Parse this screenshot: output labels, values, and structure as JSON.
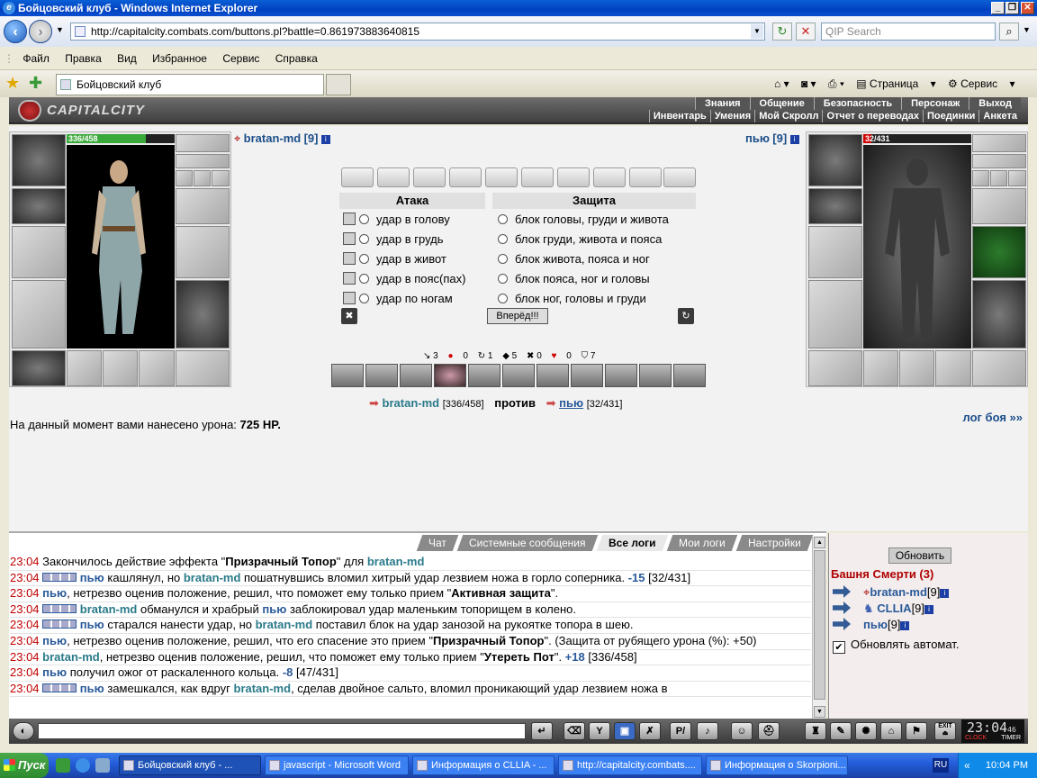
{
  "window": {
    "title": "Бойцовский клуб - Windows Internet Explorer"
  },
  "address": {
    "url": "http://capitalcity.combats.com/buttons.pl?battle=0.861973883640815",
    "search_placeholder": "QIP Search"
  },
  "menu": [
    "Файл",
    "Правка",
    "Вид",
    "Избранное",
    "Сервис",
    "Справка"
  ],
  "tab": {
    "title": "Бойцовский клуб"
  },
  "cmdbar": {
    "page": "Страница",
    "tools": "Сервис"
  },
  "game": {
    "logo": "CAPITALCITY",
    "nav_top": [
      "Знания",
      "Общение",
      "Безопасность",
      "Персонаж",
      "Выход"
    ],
    "nav_bottom": [
      "Инвентарь",
      "Умения",
      "Мой Скролл",
      "Отчет о переводах",
      "Поединки",
      "Анкета"
    ],
    "player": {
      "name": "bratan-md",
      "level": "[9]",
      "hp": "336/458",
      "hp_fraction": 0.733,
      "hp_color": "#39a939"
    },
    "enemy": {
      "name": "пью",
      "level": "[9]",
      "hp": "32/431",
      "hp_fraction": 0.074,
      "hp_color": "#d00000"
    },
    "attack_header": "Атака",
    "defense_header": "Защита",
    "attacks": [
      "удар в голову",
      "удар в грудь",
      "удар в живот",
      "удар в пояс(пах)",
      "удар по ногам"
    ],
    "defenses": [
      "блок головы, груди и живота",
      "блок груди, живота и пояса",
      "блок живота, пояса и ног",
      "блок пояса, ног и головы",
      "блок ног, головы и груди"
    ],
    "go_button": "Вперёд!!!",
    "stats": [
      "3",
      "0",
      "1",
      "5",
      "0",
      "0",
      "7"
    ],
    "versus": {
      "p1": "bratan-md",
      "p1hp": "[336/458]",
      "word": "против",
      "p2": "пью",
      "p2hp": "[32/431]"
    },
    "damage_label": "На данный момент вами нанесено урона:",
    "damage_value": "725 HP.",
    "log_link": "лог боя »»"
  },
  "logtabs": [
    "Чат",
    "Системные сообщения",
    "Все логи",
    "Мои логи",
    "Настройки"
  ],
  "log": [
    {
      "t": "23:04",
      "parts": [
        [
          "",
          "Закончилось действие эффекта \""
        ],
        [
          "bold",
          "Призрачный Топор"
        ],
        [
          "",
          "\" для "
        ],
        [
          "g",
          "bratan-md"
        ]
      ]
    },
    {
      "t": "23:04",
      "icon": true,
      "parts": [
        [
          "b",
          "пью"
        ],
        [
          "",
          " кашлянул, но "
        ],
        [
          "g",
          "bratan-md"
        ],
        [
          "",
          " пошатнувшись вломил хитрый удар лезвием ножа в горло соперника. "
        ],
        [
          "b",
          "-15"
        ],
        [
          "",
          " [32/431]"
        ]
      ]
    },
    {
      "t": "23:04",
      "parts": [
        [
          "b",
          "пью"
        ],
        [
          "",
          ", нетрезво оценив положение, решил, что поможет ему только прием \""
        ],
        [
          "bold",
          "Активная защита"
        ],
        [
          "",
          "\"."
        ]
      ]
    },
    {
      "t": "23:04",
      "icon": true,
      "parts": [
        [
          "g",
          "bratan-md"
        ],
        [
          "",
          " обманулся и храбрый "
        ],
        [
          "b",
          "пью"
        ],
        [
          "",
          " заблокировал удар маленьким топорищем в колено."
        ]
      ]
    },
    {
      "t": "23:04",
      "icon": true,
      "parts": [
        [
          "b",
          "пью"
        ],
        [
          "",
          " старался нанести удар, но "
        ],
        [
          "g",
          "bratan-md"
        ],
        [
          "",
          " поставил блок на удар занозой на рукоятке топора в шею."
        ]
      ]
    },
    {
      "t": "23:04",
      "parts": [
        [
          "b",
          "пью"
        ],
        [
          "",
          ", нетрезво оценив положение, решил, что его спасение это прием \""
        ],
        [
          "bold",
          "Призрачный Топор"
        ],
        [
          "",
          "\". (Защита от рубящего урона (%): +50)"
        ]
      ]
    },
    {
      "t": "23:04",
      "parts": [
        [
          "g",
          "bratan-md"
        ],
        [
          "",
          ", нетрезво оценив положение, решил, что поможет ему только прием \""
        ],
        [
          "bold",
          "Утереть Пот"
        ],
        [
          "",
          "\". "
        ],
        [
          "b",
          "+18"
        ],
        [
          "",
          " [336/458]"
        ]
      ]
    },
    {
      "t": "23:04",
      "parts": [
        [
          "b",
          "пью"
        ],
        [
          "",
          " получил ожог от раскаленного кольца. "
        ],
        [
          "b",
          "-8"
        ],
        [
          "",
          " [47/431]"
        ]
      ]
    },
    {
      "t": "23:04",
      "icon": true,
      "parts": [
        [
          "b",
          "пью"
        ],
        [
          "",
          " замешкался, как вдруг "
        ],
        [
          "g",
          "bratan-md"
        ],
        [
          "",
          ", сделав двойное сальто, вломил проникающий удар лезвием ножа в"
        ]
      ]
    }
  ],
  "rpanel": {
    "refresh": "Обновить",
    "location": "Башня Смерти (3)",
    "players": [
      {
        "name": "bratan-md",
        "lvl": "[9]"
      },
      {
        "name": "CLLIA",
        "lvl": "[9]"
      },
      {
        "name": "пью",
        "lvl": "[9]"
      }
    ],
    "auto": "Обновлять автомат."
  },
  "chatbar": {
    "clock": "23:04",
    "clock_sec": "46",
    "clock_tag": "CLOCK",
    "timer_tag": "TIMER",
    "exit": "EXIT"
  },
  "taskbar": {
    "start": "Пуск",
    "tasks": [
      "Бойцовский клуб - ...",
      "javascript - Microsoft Word",
      "Информация о CLLIA - ...",
      "http://capitalcity.combats....",
      "Информация о Skorpioni..."
    ],
    "lang": "RU",
    "time": "10:04 PM"
  }
}
